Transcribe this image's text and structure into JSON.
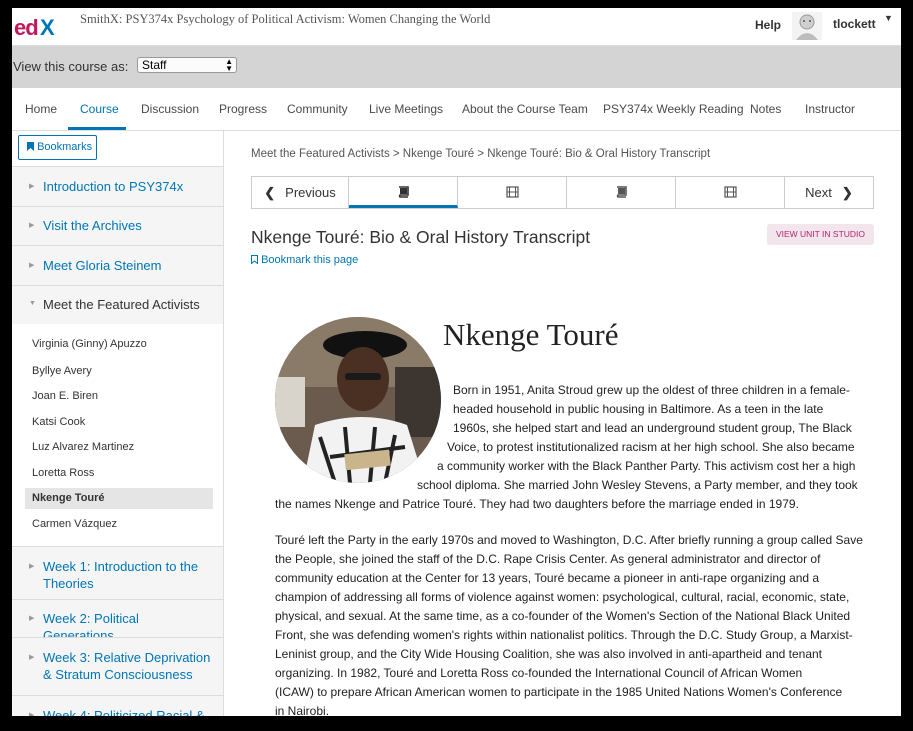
{
  "header": {
    "logo": "edX",
    "course_title": "SmithX: PSY374x Psychology of Political Activism: Women Changing the World",
    "help": "Help",
    "username": "tlockett"
  },
  "view_as": {
    "label": "View this course as:",
    "selected": "Staff"
  },
  "nav": {
    "tabs": [
      {
        "label": "Home"
      },
      {
        "label": "Course"
      },
      {
        "label": "Discussion"
      },
      {
        "label": "Progress"
      },
      {
        "label": "Community"
      },
      {
        "label": "Live Meetings"
      },
      {
        "label": "About the Course Team"
      },
      {
        "label": "PSY374x Weekly Reading"
      },
      {
        "label": "Notes"
      },
      {
        "label": "Instructor"
      }
    ],
    "active": "Course"
  },
  "sidebar": {
    "bookmarks": "Bookmarks",
    "sections": [
      {
        "label": "Introduction to PSY374x"
      },
      {
        "label": "Visit the Archives"
      },
      {
        "label": "Meet Gloria Steinem"
      },
      {
        "label": "Meet the Featured Activists"
      },
      {
        "label": "Week 1: Introduction to the Theories"
      },
      {
        "label": "Week 2: Political Generations"
      },
      {
        "label": "Week 3: Relative Deprivation & Stratum Consciousness"
      },
      {
        "label": "Week 4: Politicized Racial &"
      }
    ],
    "subsections": [
      {
        "label": "Virginia (Ginny) Apuzzo"
      },
      {
        "label": "Byllye Avery"
      },
      {
        "label": "Joan E. Biren"
      },
      {
        "label": "Katsi Cook"
      },
      {
        "label": "Luz Alvarez Martinez"
      },
      {
        "label": "Loretta Ross"
      },
      {
        "label": "Nkenge Touré"
      },
      {
        "label": "Carmen Vázquez"
      }
    ]
  },
  "main": {
    "breadcrumb": "Meet the Featured Activists > Nkenge Touré > Nkenge Touré: Bio & Oral History Transcript",
    "previous": "Previous",
    "next": "Next",
    "unit_title": "Nkenge Touré: Bio & Oral History Transcript",
    "view_in_studio": "VIEW UNIT IN STUDIO",
    "bookmark_page": "Bookmark this page",
    "person_name": "Nkenge Touré",
    "bio_p1": [
      "Born in 1951, Anita Stroud grew up the oldest of three children in a female-",
      "headed household in public housing in Baltimore. As a teen in the late",
      "1960s, she helped start and lead an underground student group, The Black",
      "Voice, to protest institutionalized racism at her high school. She also became",
      "a community worker with the Black Panther Party. This activism cost her a high",
      "school diploma. She married John Wesley Stevens, a Party member, and they took",
      "the names Nkenge and Patrice Touré. They had two daughters before the marriage ended in 1979."
    ],
    "bio_p2": [
      "Touré left the Party in the early 1970s and moved to Washington, D.C. After briefly running a group called Save",
      "the People, she joined the staff of the D.C. Rape Crisis Center. As general administrator and director of",
      "community education at the Center for 13 years, Touré became a pioneer in anti-rape organizing and a",
      "champion of addressing all forms of violence against women: psychological, cultural, racial, economic, state,",
      "physical, and sexual. At the same time, as a co-founder of the Women's Section of the National Black United",
      "Front, she was defending women's rights within nationalist politics. Through the D.C. Study Group, a Marxist-",
      "Leninist group, and the City Wide Housing Coalition, she was also involved in anti-apartheid and tenant",
      "organizing. In 1982, Touré  and Loretta Ross co-founded the International Council of African Women",
      "(ICAW) to prepare African American women to participate in the 1985 United Nations Women's Conference",
      "in Nairobi."
    ]
  },
  "colors": {
    "accent": "#0075b4",
    "studio": "#b0246e"
  }
}
